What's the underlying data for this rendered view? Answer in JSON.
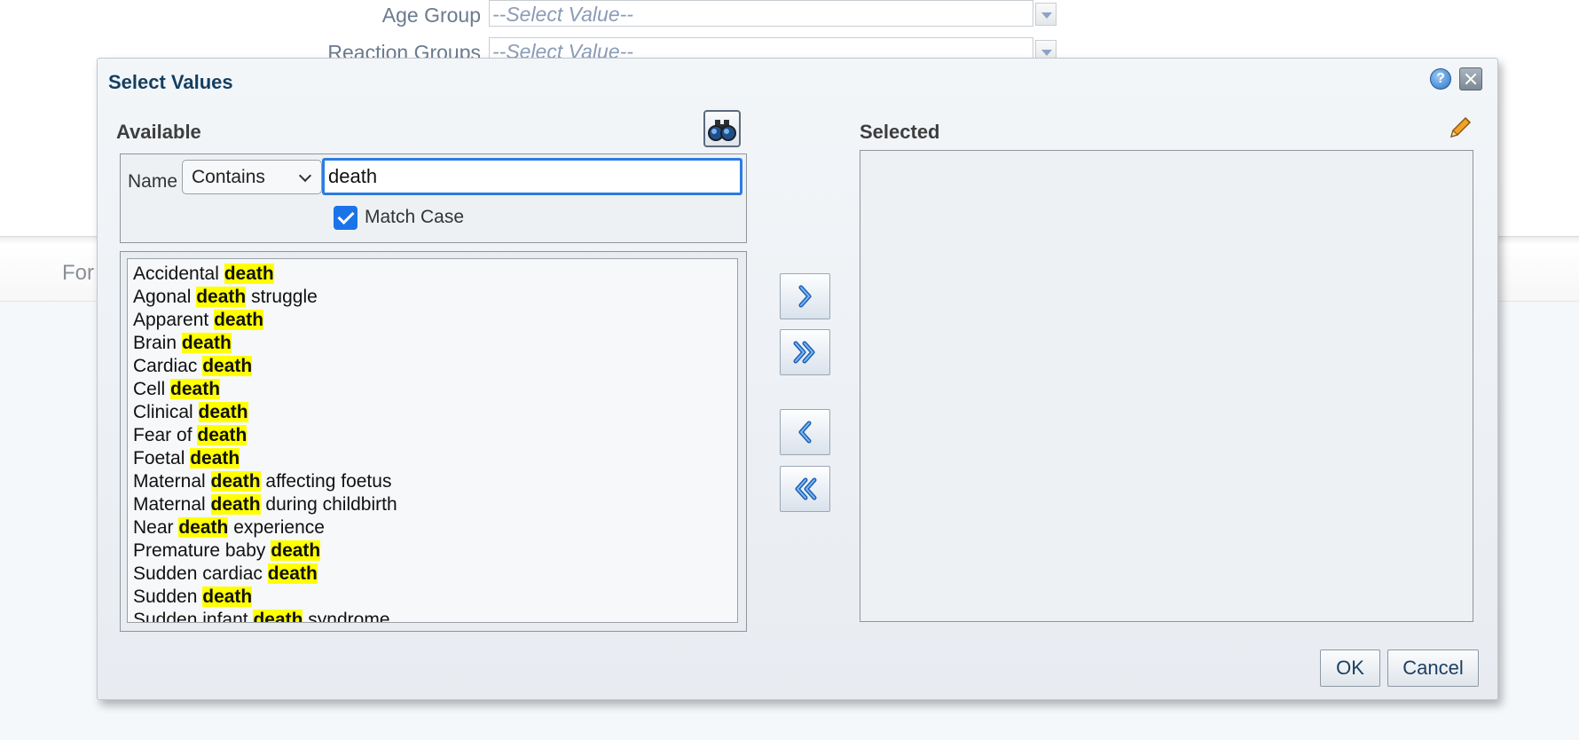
{
  "background": {
    "rows": [
      {
        "label": "Age Group",
        "value": "--Select Value--"
      },
      {
        "label": "Reaction Groups",
        "value": "--Select Value--"
      }
    ],
    "band_text": "For"
  },
  "dialog": {
    "title": "Select Values",
    "help_icon": "help-icon",
    "close_icon": "close-icon",
    "available": {
      "title": "Available",
      "find_icon": "binoculars-icon",
      "filter": {
        "name_label": "Name",
        "operator": "Contains",
        "search_value": "death",
        "match_case_label": "Match Case",
        "match_case_checked": true
      },
      "items": [
        {
          "before": "Accidental ",
          "match": "death",
          "after": ""
        },
        {
          "before": "Agonal ",
          "match": "death",
          "after": " struggle"
        },
        {
          "before": "Apparent ",
          "match": "death",
          "after": ""
        },
        {
          "before": "Brain ",
          "match": "death",
          "after": ""
        },
        {
          "before": "Cardiac ",
          "match": "death",
          "after": ""
        },
        {
          "before": "Cell ",
          "match": "death",
          "after": ""
        },
        {
          "before": "Clinical ",
          "match": "death",
          "after": ""
        },
        {
          "before": "Fear of ",
          "match": "death",
          "after": ""
        },
        {
          "before": "Foetal ",
          "match": "death",
          "after": ""
        },
        {
          "before": "Maternal ",
          "match": "death",
          "after": " affecting foetus"
        },
        {
          "before": "Maternal ",
          "match": "death",
          "after": " during childbirth"
        },
        {
          "before": "Near ",
          "match": "death",
          "after": " experience"
        },
        {
          "before": "Premature baby ",
          "match": "death",
          "after": ""
        },
        {
          "before": "Sudden cardiac ",
          "match": "death",
          "after": ""
        },
        {
          "before": "Sudden ",
          "match": "death",
          "after": ""
        },
        {
          "before": "Sudden infant ",
          "match": "death",
          "after": " syndrome"
        }
      ]
    },
    "move_buttons": [
      {
        "name": "move-selected-button",
        "icon": "chevron-right-icon"
      },
      {
        "name": "move-all-button",
        "icon": "double-chevron-right-icon"
      },
      {
        "name": "remove-selected-button",
        "icon": "chevron-left-icon"
      },
      {
        "name": "remove-all-button",
        "icon": "double-chevron-left-icon"
      }
    ],
    "selected": {
      "title": "Selected",
      "edit_icon": "pencil-icon",
      "items": []
    },
    "ok_label": "OK",
    "cancel_label": "Cancel",
    "colors": {
      "title": "#153e5e",
      "highlight": "#ffff00",
      "focus_border": "#2a7de1",
      "checkbox": "#1a73e8"
    }
  }
}
